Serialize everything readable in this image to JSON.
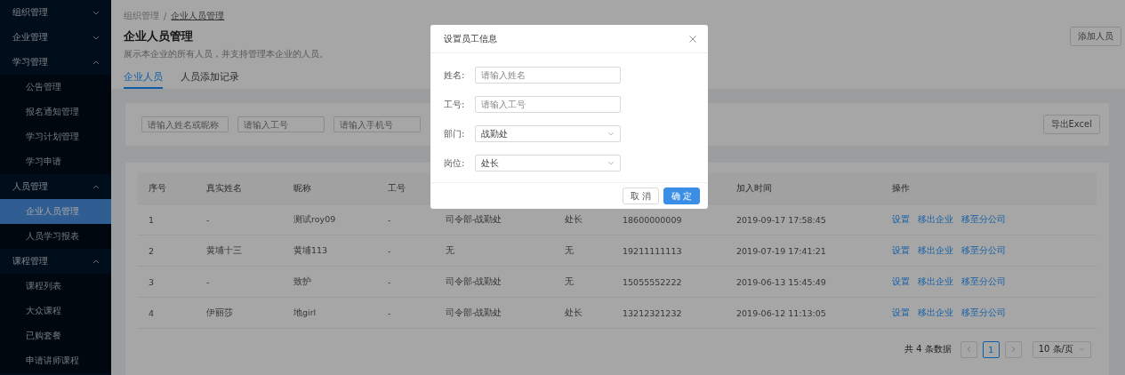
{
  "sidebar": {
    "groups": [
      {
        "label": "组织管理",
        "expanded": false
      },
      {
        "label": "企业管理",
        "expanded": false
      },
      {
        "label": "学习管理",
        "expanded": true,
        "children": [
          {
            "label": "公告管理",
            "selected": false
          },
          {
            "label": "报名通知管理",
            "selected": false
          },
          {
            "label": "学习计划管理",
            "selected": false
          },
          {
            "label": "学习申请",
            "selected": false
          }
        ]
      },
      {
        "label": "人员管理",
        "expanded": true,
        "children": [
          {
            "label": "企业人员管理",
            "selected": true
          },
          {
            "label": "人员学习报表",
            "selected": false
          }
        ]
      },
      {
        "label": "课程管理",
        "expanded": true,
        "children": [
          {
            "label": "课程列表",
            "selected": false
          },
          {
            "label": "大众课程",
            "selected": false
          },
          {
            "label": "已购套餐",
            "selected": false
          },
          {
            "label": "申请讲师课程",
            "selected": false
          }
        ]
      }
    ]
  },
  "breadcrumb": {
    "separator": "/",
    "items": [
      "组织管理",
      "企业人员管理"
    ]
  },
  "page": {
    "title": "企业人员管理",
    "description": "展示本企业的所有人员，并支持管理本企业的人员。",
    "add_button": "添加人员"
  },
  "tabs": [
    {
      "label": "企业人员",
      "selected": true
    },
    {
      "label": "人员添加记录",
      "selected": false
    }
  ],
  "filters": [
    {
      "placeholder": "请输入姓名或昵称"
    },
    {
      "placeholder": "请输入工号"
    },
    {
      "placeholder": "请输入手机号"
    }
  ],
  "export_button": "导出Excel",
  "table": {
    "columns": [
      {
        "label": "序号"
      },
      {
        "label": "真实姓名"
      },
      {
        "label": "昵称"
      },
      {
        "label": "工号"
      },
      {},
      {},
      {},
      {
        "label": "加入时间"
      },
      {
        "label": "操作"
      }
    ],
    "rows": [
      {
        "cells": [
          "1",
          "-",
          "测试roy09",
          "-",
          "司令部-战勤处",
          "处长",
          "18600000009",
          "2019-09-17 17:58:45"
        ],
        "actions": [
          "设置",
          "移出企业",
          "移至分公司"
        ]
      },
      {
        "cells": [
          "2",
          "黄埔十三",
          "黄埔113",
          "-",
          "无",
          "无",
          "19211111113",
          "2019-07-19 17:41:21"
        ],
        "actions": [
          "设置",
          "移出企业",
          "移至分公司"
        ]
      },
      {
        "cells": [
          "3",
          "-",
          "致护",
          "-",
          "司令部-战勤处",
          "无",
          "15055552222",
          "2019-06-13 15:45:49"
        ],
        "actions": [
          "设置",
          "移出企业",
          "移至分公司"
        ]
      },
      {
        "cells": [
          "4",
          "伊丽莎",
          "地girl",
          "-",
          "司令部-战勤处",
          "处长",
          "13212321232",
          "2019-06-12 11:13:05"
        ],
        "actions": [
          "设置",
          "移出企业",
          "移至分公司"
        ]
      }
    ]
  },
  "pagination": {
    "total": "共 4 条数据",
    "pages": [
      {
        "label": "1",
        "selected": true
      }
    ],
    "page_size": "10 条/页"
  },
  "modal": {
    "title": "设置员工信息",
    "fields": [
      {
        "label": "姓名:",
        "kind": "input",
        "placeholder": "请输入姓名"
      },
      {
        "label": "工号:",
        "kind": "input",
        "placeholder": "请输入工号"
      },
      {
        "label": "部门:",
        "kind": "select",
        "value": "战勤处"
      },
      {
        "label": "岗位:",
        "kind": "select",
        "value": "处长"
      }
    ],
    "buttons": [
      {
        "label": "取 消",
        "kind": "default"
      },
      {
        "label": "确 定",
        "kind": "primary"
      }
    ]
  }
}
